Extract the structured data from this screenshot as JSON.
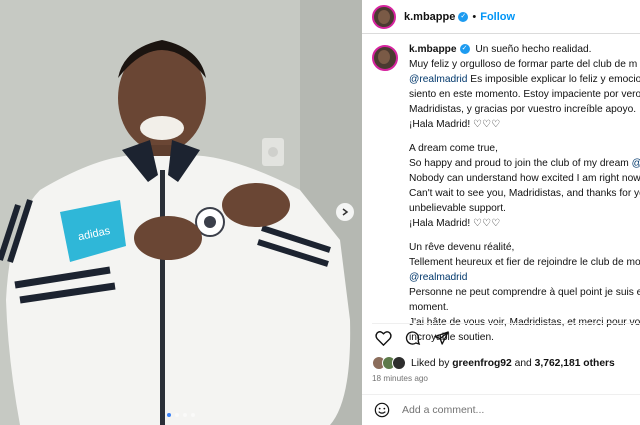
{
  "header": {
    "username": "k.mbappe",
    "follow_label": "Follow",
    "separator": "•"
  },
  "caption": {
    "username": "k.mbappe",
    "paragraphs": [
      {
        "lines": [
          {
            "segments": [
              {
                "text": "Un sueño hecho realidad.",
                "type": "text"
              }
            ]
          },
          {
            "segments": [
              {
                "text": "Muy feliz y orgulloso de formar parte del club de m",
                "type": "text"
              }
            ]
          },
          {
            "segments": [
              {
                "text": "@realmadrid",
                "type": "link"
              },
              {
                "text": " Es imposible explicar lo feliz y emocio",
                "type": "text"
              }
            ]
          },
          {
            "segments": [
              {
                "text": "siento en este momento. Estoy impaciente por veros",
                "type": "text"
              }
            ]
          },
          {
            "segments": [
              {
                "text": "Madridistas, y gracias por vuestro increíble apoyo.",
                "type": "text"
              }
            ]
          },
          {
            "segments": [
              {
                "text": "¡Hala Madrid! ♡♡♡",
                "type": "text"
              }
            ]
          }
        ]
      },
      {
        "lines": [
          {
            "segments": [
              {
                "text": "A dream come true,",
                "type": "text"
              }
            ]
          },
          {
            "segments": [
              {
                "text": "So happy and proud to join the club of my dream ",
                "type": "text"
              },
              {
                "text": "@",
                "type": "link"
              }
            ]
          },
          {
            "segments": [
              {
                "text": "Nobody can understand how excited I am right now",
                "type": "text"
              }
            ]
          },
          {
            "segments": [
              {
                "text": "Can't wait to see you, Madridistas, and thanks for yo",
                "type": "text"
              }
            ]
          },
          {
            "segments": [
              {
                "text": "unbelievable support.",
                "type": "text"
              }
            ]
          },
          {
            "segments": [
              {
                "text": "¡Hala Madrid! ♡♡♡",
                "type": "text"
              }
            ]
          }
        ]
      },
      {
        "lines": [
          {
            "segments": [
              {
                "text": "Un rêve devenu réalité,",
                "type": "text"
              }
            ]
          },
          {
            "segments": [
              {
                "text": "Tellement heureux et fier de rejoindre le club de mo",
                "type": "text"
              }
            ]
          },
          {
            "segments": [
              {
                "text": "@realmadrid",
                "type": "link"
              }
            ]
          },
          {
            "segments": [
              {
                "text": "Personne ne peut comprendre à quel point je suis e",
                "type": "text"
              }
            ]
          },
          {
            "segments": [
              {
                "text": "moment.",
                "type": "text"
              }
            ]
          },
          {
            "segments": [
              {
                "text": "J'ai hâte de vous voir, Madridistas, et merci pour vot",
                "type": "text"
              }
            ]
          },
          {
            "segments": [
              {
                "text": "incroyable soutien.",
                "type": "text"
              }
            ]
          }
        ]
      }
    ]
  },
  "actions": {
    "icons": [
      "heart-icon",
      "comment-icon",
      "share-icon"
    ],
    "liked_prefix": "Liked by ",
    "liked_user": "greenfrog92",
    "liked_and": " and ",
    "liked_count": "3,762,181 others",
    "timestamp": "18 minutes ago"
  },
  "comment": {
    "placeholder": "Add a comment..."
  },
  "carousel": {
    "slide_count": 4,
    "active_index": 0
  },
  "photo": {
    "jacket_logo_text": "adidas"
  },
  "colors": {
    "link": "#00376b",
    "follow": "#0095f6",
    "verified": "#1d9bf0",
    "jacket_accent": "#2fb7d8",
    "active_dot": "#3b82f6"
  }
}
